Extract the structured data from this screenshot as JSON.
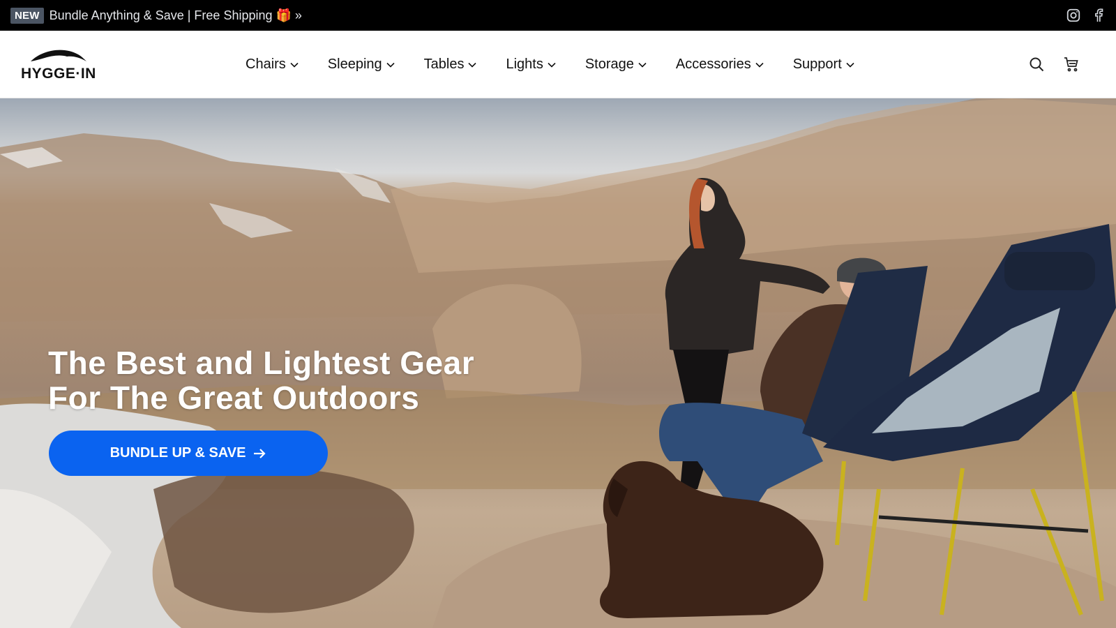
{
  "announcement": {
    "badge": "NEW",
    "text": "Bundle Anything & Save | Free Shipping 🎁 »"
  },
  "social": {
    "icons": [
      "instagram-icon",
      "facebook-icon"
    ]
  },
  "header": {
    "logo_text": "HYGGE·IN",
    "nav": [
      {
        "label": "Chairs"
      },
      {
        "label": "Sleeping"
      },
      {
        "label": "Tables"
      },
      {
        "label": "Lights"
      },
      {
        "label": "Storage"
      },
      {
        "label": "Accessories"
      },
      {
        "label": "Support"
      }
    ],
    "icons": [
      "search-icon",
      "cart-icon"
    ]
  },
  "hero": {
    "title_line1": "The Best and Lightest Gear",
    "title_line2": "For The Great Outdoors",
    "cta_label": "BUNDLE UP & SAVE",
    "cta_color": "#0a63f0"
  },
  "colors": {
    "announcement_bg": "#000000",
    "badge_bg": "#4b5563",
    "header_bg": "#ffffff"
  }
}
